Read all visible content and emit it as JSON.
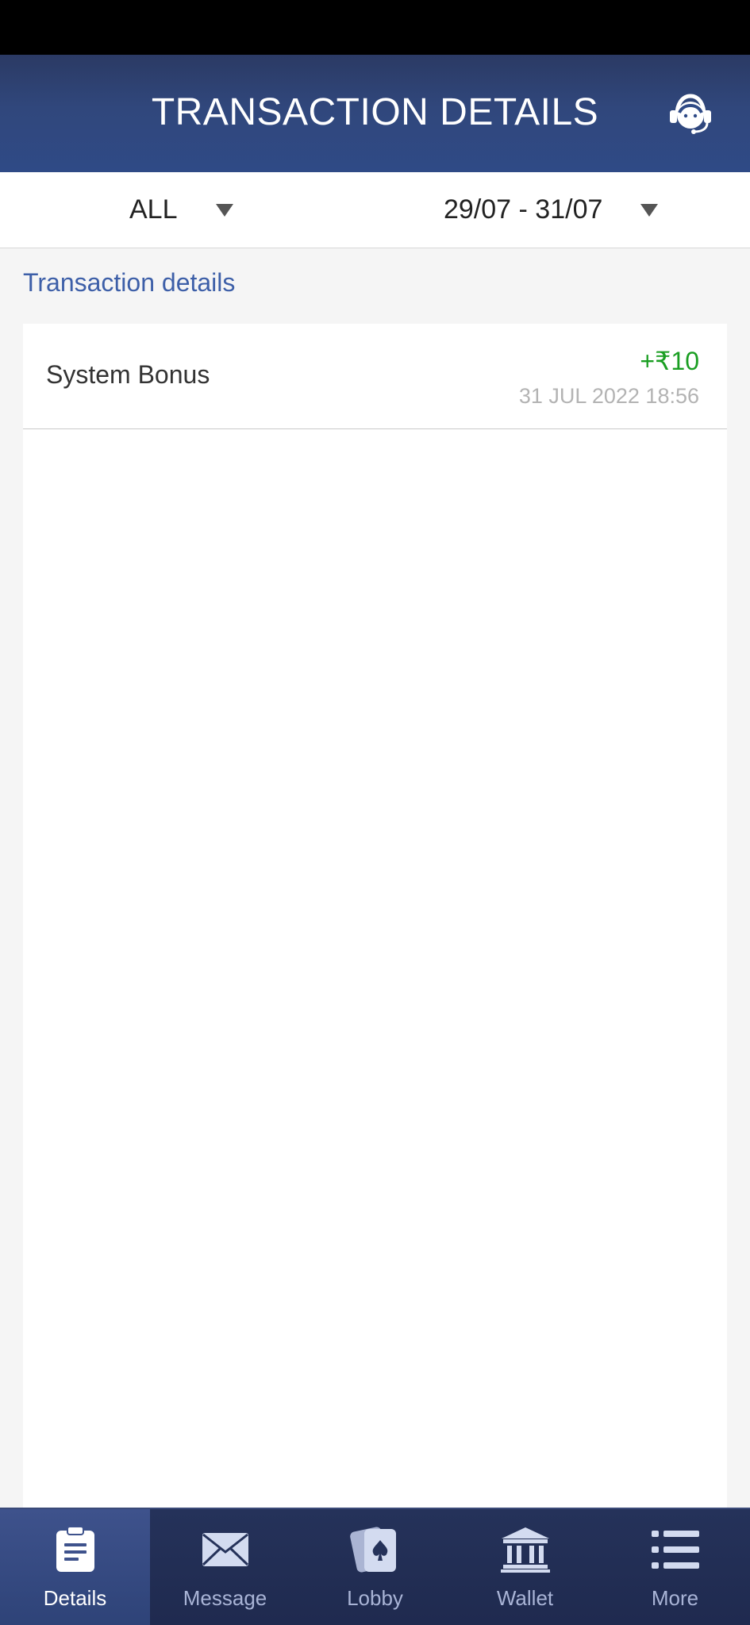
{
  "header": {
    "title": "TRANSACTION DETAILS",
    "support_icon": "headset-icon"
  },
  "filters": {
    "type_value": "ALL",
    "date_range_value": "29/07 - 31/07"
  },
  "section": {
    "title": "Transaction details"
  },
  "transactions": [
    {
      "name": "System Bonus",
      "amount": "+₹10",
      "datetime": "31 JUL 2022 18:56"
    }
  ],
  "colors": {
    "header_bg": "#2f4a86",
    "accent_text": "#3d5fa8",
    "amount_positive": "#1a9e22",
    "tabbar_bg": "#1f2a4f"
  },
  "tabbar": {
    "active": "Details",
    "items": [
      {
        "label": "Details",
        "icon": "clipboard-icon"
      },
      {
        "label": "Message",
        "icon": "envelope-icon"
      },
      {
        "label": "Lobby",
        "icon": "cards-icon"
      },
      {
        "label": "Wallet",
        "icon": "bank-icon"
      },
      {
        "label": "More",
        "icon": "list-menu-icon"
      }
    ]
  }
}
